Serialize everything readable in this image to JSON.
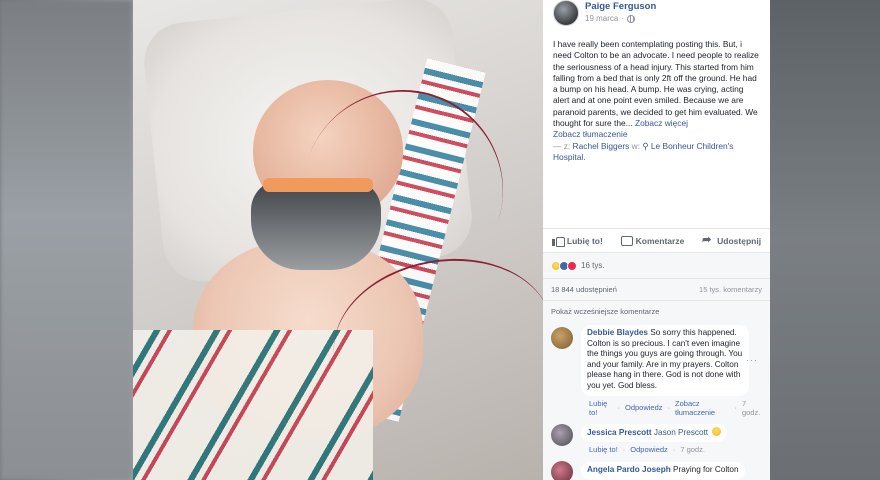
{
  "post": {
    "author": "Paige Ferguson",
    "date": "19 marca",
    "meta_separator": "·",
    "text": "I have really been contemplating posting this. But, i need Colton to be an advocate. I need people to realize the seriousness of a head injury. This started from him falling from a bed that is only 2ft off the ground. He had a bump on his head. A bump. He was crying, acting alert and at one point even smiled. Because we are paranoid parents, we decided to get him evaluated. We thought for sure the...",
    "see_more": "Zobacz więcej",
    "see_translation": "Zobacz tłumaczenie",
    "with_prefix": "— z:",
    "tagged_person": "Rachel Biggers",
    "at_label": "w:",
    "location": "Le Bonheur Children's Hospital.",
    "location_icon": "map-pin-icon"
  },
  "actions": {
    "like": "Lubię to!",
    "comment": "Komentarze",
    "share": "Udostępnij"
  },
  "reactions": {
    "types": [
      "sad",
      "like",
      "love"
    ],
    "count": "16 tys."
  },
  "stats": {
    "shares": "18 844 udostępnień",
    "comments": "15 tys. komentarzy"
  },
  "more_comments": "Pokaż wcześniejsze komentarze",
  "comments": [
    {
      "name": "Debbie Blaydes",
      "text": "So sorry this happened. Colton is so precious. I can't even imagine the things you guys are going through. You and your family. Are in my prayers. Colton please hang in there. God is not done with you yet. God bless.",
      "like": "Lubię to!",
      "reply": "Odpowiedz",
      "translate": "Zobacz tłumaczenie",
      "time": "7 godz.",
      "avatar_color": "#8a6a3c"
    },
    {
      "name": "Jessica Prescott",
      "text": "Jason Prescott",
      "like": "Lubię to!",
      "reply": "Odpowiedz",
      "time": "7 godz.",
      "avatar_color": "#5f5a63"
    },
    {
      "name": "Angela Pardo Joseph",
      "text": "Praying for Colton",
      "avatar_color": "#7a3c4a"
    }
  ],
  "colors": {
    "link_blue": "#365899",
    "text": "#1d2129",
    "muted": "#90949c"
  }
}
